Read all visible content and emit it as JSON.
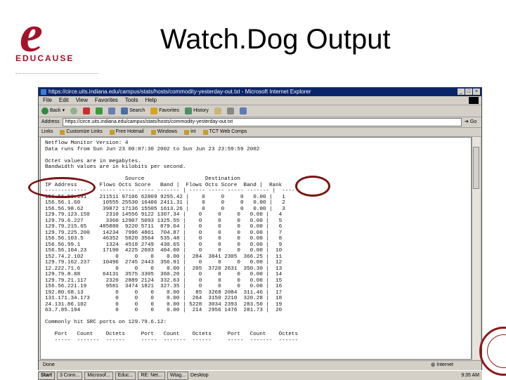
{
  "slide": {
    "title": "Watch.Dog Output",
    "logo_letter": "e",
    "logo_word": "EDUCAUSE"
  },
  "browser": {
    "window_title": "https://circe.uits.indiana.edu/campus/stats/hosts/commodity-yesterday-out.txt - Microsoft Internet Explorer",
    "menu": [
      "File",
      "Edit",
      "View",
      "Favorites",
      "Tools",
      "Help"
    ],
    "toolbar": {
      "back": "Back",
      "forward": "",
      "stop": "",
      "refresh": "",
      "home": "",
      "search": "Search",
      "favorites": "Favorites",
      "history": "History"
    },
    "address_label": "Address",
    "address_value": "https://circe.uits.indiana.edu/campus/stats/hosts/commodity-yesterday-out.txt",
    "go_label": "Go",
    "links_label": "Links",
    "links": [
      "Customize Links",
      "Free Hotmail",
      "Windows",
      "int",
      "TCT Web Comps"
    ],
    "status_left": "Done",
    "status_zone": "Internet"
  },
  "report": {
    "lines": [
      "Netflow Monitor Version: 4",
      "Data runs from Sun Jun 23 00:07:30 2002 to Sun Jun 23 23:59:59 2002",
      "",
      "Octet values are in megabytes.",
      "Bandwidth values are in kilobits per second.",
      "",
      "                         Source                   Destination",
      "IP Address       Flows Octs Score   Band |  Flows Octs Score  Band |  Rank",
      "-------------    ----- ----- ----- ------- | ----- ----- ----- ------- |  ----",
      "156.56.56.191    211511 97106 62809 9255.42 |    0     0     0   0.00 |   1",
      "156.56.1.60       10555 25530 16406 2411.31 |    0     0     0   0.00 |   2",
      "156.56.98.62      39872 17136 15505 1613.26 |    0     0     0   0.00 |   3",
      "129.79.123.150     2310 14556 9122 1307.34 |    0     0     0   0.00 |   4",
      "129.79.6.227       3360 12907 5093 1325.55 |    0     0     0   0.00 |   5",
      "129.79.215.65    485880  9220 5711  879.64 |    0     0     0   0.00 |   6",
      "129.79.225.200    14234  7996 4861  704.87 |    0     0     0   0.00 |   7",
      "156.56.103.5      46352  5820 3564  535.48 |    0     0     0   0.00 |   8",
      "156.56.99.1        1324  4518 2749  430.65 |    0     0     0   0.00 |   9",
      "156.56.104.23     17190  4225 2603  404.00 |    0     0     0   0.00 |  10",
      "152.74.2.102          0     0    0    0.00 |  284  3841 2305  366.25 |  11",
      "129.79.162.237    10496  2745 2443  356.91 |    0     0     0   0.00 |  12",
      "12.222.71.6           0     0    0    0.00 |  205  3720 2631  350.30 |  13",
      "129.79.8.88       64131  3575 3305  360.20 |    0     0     0   0.00 |  14",
      "129.79.21.117      2320  2889 2124  332.63 |    0     0     0   0.00 |  15",
      "156.56.221.19      9581  3474 1821  327.35 |    0     0     0   0.00 |  16",
      "192.80.68.13          0     0    0    0.00 |   85  3268 2084  311.46 |  17",
      "131.171.34.173        0     0    0    0.00 |  264  3150 2210  320.28 |  18",
      "24.131.86.102         0     0    0    0.00 | 5228  3034 2393  283.50 |  19",
      "63.7.85.194           0     0    0    0.00 |  214  2956 1476  281.73 |  20",
      "",
      "Commonly hit SRC ports on 129.79.6.12:",
      "",
      "   Port   Count    Octets     Port   Count    Octets     Port   Count    Octets",
      "   -----  -------  ------     -----  -------  ------     -----  -------  ------"
    ]
  },
  "taskbar": {
    "start": "Start",
    "tasks": [
      "3 Conn...",
      "Microsof...",
      "Educ...",
      "RE: Net...",
      "Wtag..."
    ],
    "tray": "Desktop",
    "clock": "9:35 AM"
  },
  "colors": {
    "accent": "#a3122a",
    "ellipse": "#7a1414",
    "titlebar": "#0a246a"
  }
}
